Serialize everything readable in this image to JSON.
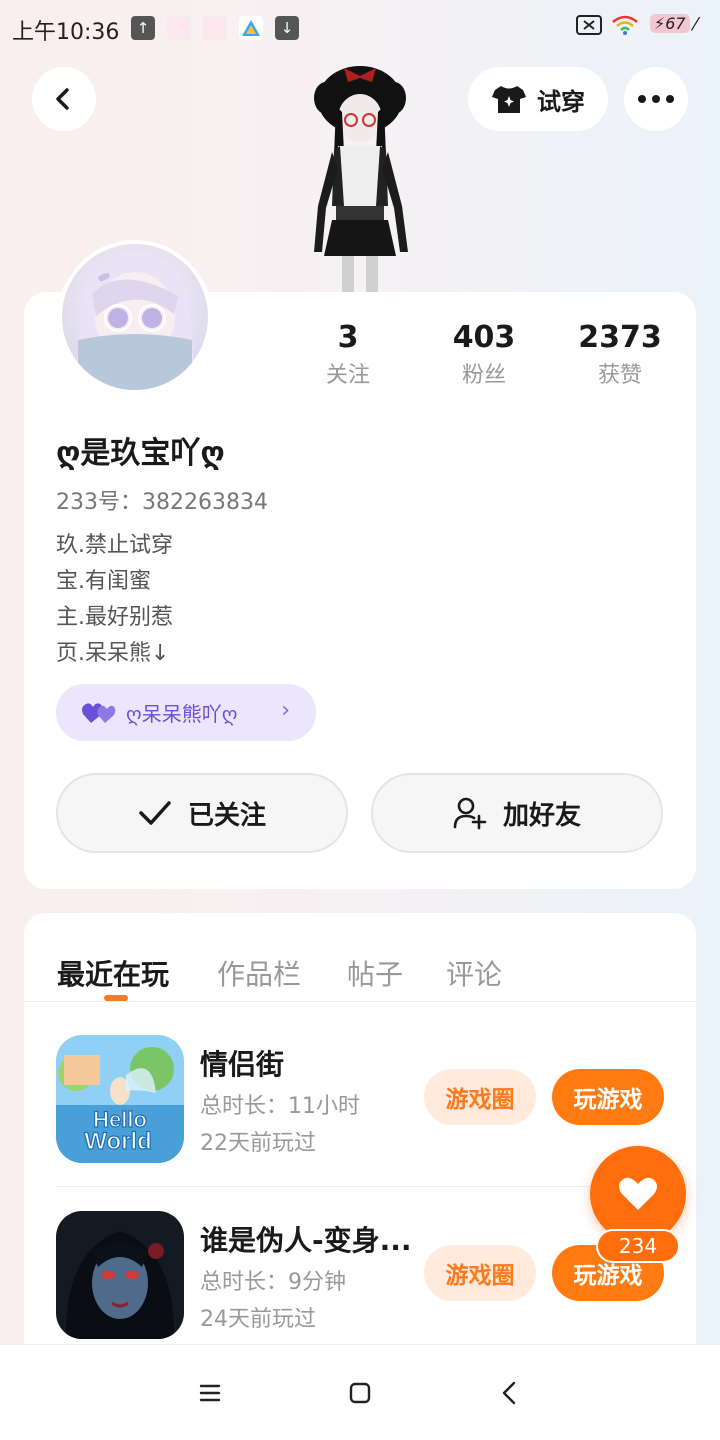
{
  "status_bar": {
    "time": "上午10:36",
    "battery": "67"
  },
  "top_nav": {
    "try_on_label": "试穿"
  },
  "profile": {
    "stats": [
      {
        "value": "3",
        "label": "关注"
      },
      {
        "value": "403",
        "label": "粉丝"
      },
      {
        "value": "2373",
        "label": "获赞"
      }
    ],
    "nickname": "ღ是玖宝吖ღ",
    "uid_label": "233号：",
    "uid_value": "382263834",
    "bio_lines": [
      "玖.禁止试穿",
      "宝.有闺蜜",
      "主.最好别惹",
      "页.呆呆熊↓"
    ],
    "close_friend": "ღ呆呆熊吖ღ",
    "follow_button": "已关注",
    "add_friend_button": "加好友"
  },
  "tabs": [
    {
      "label": "最近在玩",
      "active": true
    },
    {
      "label": "作品栏",
      "active": false
    },
    {
      "label": "帖子",
      "active": false
    },
    {
      "label": "评论",
      "active": false
    }
  ],
  "games": [
    {
      "name": "情侣街",
      "duration": "总时长：11小时",
      "last_played": "22天前玩过",
      "circle_label": "游戏圈",
      "play_label": "玩游戏",
      "icon_text": "Hello World"
    },
    {
      "name": "谁是伪人-变身...",
      "duration": "总时长：9分钟",
      "last_played": "24天前玩过",
      "circle_label": "游戏圈",
      "play_label": "玩游戏"
    }
  ],
  "like": {
    "count": "234"
  },
  "colors": {
    "accent": "#ff7a10",
    "accent_light": "#ffeadc",
    "close_friend_bg": "#ebe6fb",
    "close_friend_text": "#6a4fd8"
  }
}
